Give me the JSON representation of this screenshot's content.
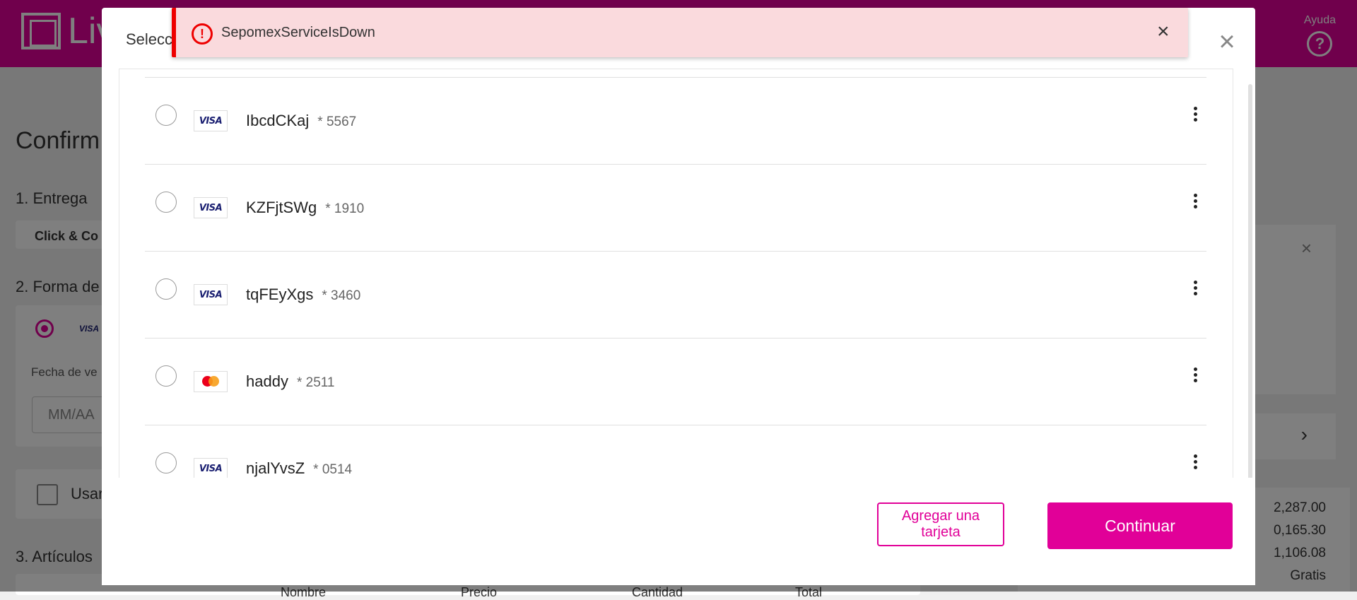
{
  "header": {
    "logo_text": "Liv",
    "help_label": "Ayuda",
    "help_icon": "?"
  },
  "background": {
    "title": "Confirm",
    "section_delivery": "1. Entrega",
    "delivery_value": "Click & Co",
    "section_payment": "2. Forma de",
    "brand_label": "VISA",
    "expiry_label": "Fecha de ve",
    "expiry_placeholder": "MM/AA",
    "use_label": "Usar",
    "section_items": "3. Artículos",
    "table_headers": [
      "Nombre",
      "Precio",
      "Cantidad",
      "Total"
    ],
    "amounts": [
      "2,287.00",
      "0,165.30",
      "1,106.08",
      "Gratis"
    ]
  },
  "modal": {
    "title": "Selecc",
    "close_icon": "×",
    "cards": [
      {
        "brand": "visa",
        "brand_label": "VISA",
        "name": "IbcdCKaj",
        "last4": "* 5567"
      },
      {
        "brand": "visa",
        "brand_label": "VISA",
        "name": "KZFjtSWg",
        "last4": "* 1910"
      },
      {
        "brand": "visa",
        "brand_label": "VISA",
        "name": "tqFEyXgs",
        "last4": "* 3460"
      },
      {
        "brand": "mastercard",
        "brand_label": "",
        "name": "haddy",
        "last4": "* 2511"
      },
      {
        "brand": "visa",
        "brand_label": "VISA",
        "name": "njalYvsZ",
        "last4": "* 0514"
      }
    ],
    "add_card_label": "Agregar una tarjeta",
    "continue_label": "Continuar"
  },
  "toast": {
    "icon": "!",
    "message": "SepomexServiceIsDown",
    "close_icon": "×"
  },
  "colors": {
    "accent": "#e10098",
    "error": "#ee0000",
    "toast_bg": "#fadadd"
  }
}
